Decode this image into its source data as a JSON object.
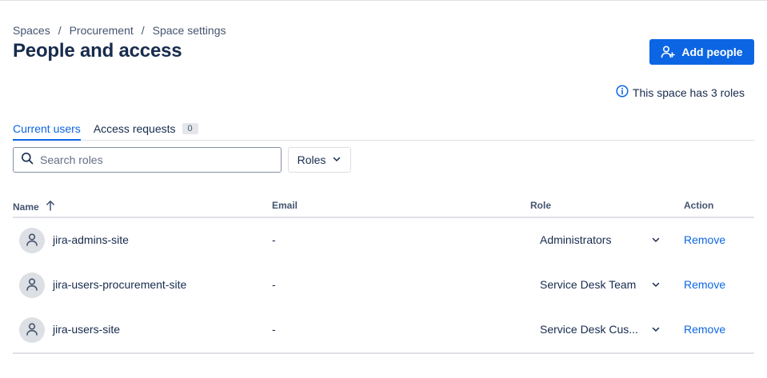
{
  "breadcrumb": [
    "Spaces",
    "Procurement",
    "Space settings"
  ],
  "breadcrumb_sep": "/",
  "page_title": "People and access",
  "add_button": {
    "label": "Add people",
    "icon": "add-person-icon"
  },
  "roles_info": {
    "text": "This space has 3 roles",
    "icon": "info-icon"
  },
  "tabs": [
    {
      "label": "Current users",
      "active": true
    },
    {
      "label": "Access requests",
      "badge": "0",
      "active": false
    }
  ],
  "search": {
    "placeholder": "Search roles",
    "value": "",
    "icon": "search-icon"
  },
  "roles_filter": {
    "label": "Roles",
    "icon": "chevron-down-icon"
  },
  "table": {
    "headers": {
      "name": "Name",
      "email": "Email",
      "role": "Role",
      "action": "Action"
    },
    "sort": {
      "column": "Name",
      "direction": "ascending",
      "icon": "arrow-up-icon"
    },
    "rows": [
      {
        "name": "jira-admins-site",
        "email": "-",
        "role": "Administrators",
        "action": "Remove"
      },
      {
        "name": "jira-users-procurement-site",
        "email": "-",
        "role": "Service Desk Team",
        "action": "Remove"
      },
      {
        "name": "jira-users-site",
        "email": "-",
        "role": "Service Desk Cus...",
        "action": "Remove"
      }
    ]
  },
  "colors": {
    "primary": "#0c66e4",
    "text": "#172b4d",
    "subtle_text": "#44546f",
    "border": "#dfe1e6",
    "avatar_bg": "#dcdfe4"
  }
}
